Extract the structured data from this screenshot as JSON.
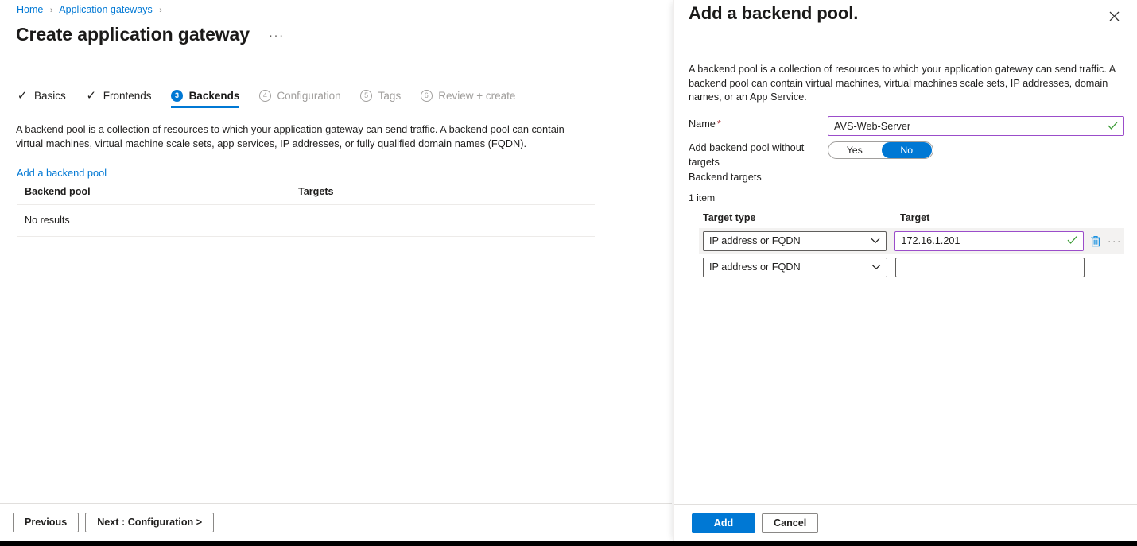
{
  "breadcrumb": {
    "items": [
      "Home",
      "Application gateways"
    ],
    "separator": "›"
  },
  "page": {
    "title": "Create application gateway",
    "ellipsis": "···"
  },
  "wizard": {
    "steps": [
      {
        "label": "Basics",
        "mark": "✓",
        "state": "done"
      },
      {
        "label": "Frontends",
        "mark": "✓",
        "state": "done"
      },
      {
        "label": "Backends",
        "mark": "3",
        "state": "active"
      },
      {
        "label": "Configuration",
        "mark": "4",
        "state": "disabled"
      },
      {
        "label": "Tags",
        "mark": "5",
        "state": "disabled"
      },
      {
        "label": "Review + create",
        "mark": "6",
        "state": "disabled"
      }
    ]
  },
  "main": {
    "description": "A backend pool is a collection of resources to which your application gateway can send traffic. A backend pool can contain virtual machines, virtual machine scale sets, app services, IP addresses, or fully qualified domain names (FQDN).",
    "add_pool_link": "Add a backend pool",
    "table": {
      "columns": [
        "Backend pool",
        "Targets"
      ],
      "empty_text": "No results"
    }
  },
  "footer": {
    "previous_label": "Previous",
    "next_label": "Next : Configuration >"
  },
  "panel": {
    "title": "Add a backend pool.",
    "close_icon": "✕",
    "description": "A backend pool is a collection of resources to which your application gateway can send traffic. A backend pool can contain virtual machines, virtual machines scale sets, IP addresses, domain names, or an App Service.",
    "name_field": {
      "label": "Name",
      "required_marker": "*",
      "value": "AVS-Web-Server",
      "placeholder": "",
      "valid_icon": "✓"
    },
    "without_targets": {
      "label": "Add backend pool without targets",
      "options": [
        "Yes",
        "No"
      ],
      "selected": "No"
    },
    "backend_targets_label": "Backend targets",
    "item_count": "1 item",
    "targets_table": {
      "columns": [
        "Target type",
        "Target"
      ],
      "rows": [
        {
          "target_type": "IP address or FQDN",
          "target_value": "172.16.1.201",
          "target_placeholder": "",
          "valid_icon": "✓",
          "highlighted": true,
          "delete_icon": "delete-icon",
          "more_icon": "···"
        },
        {
          "target_type": "IP address or FQDN",
          "target_value": "",
          "target_placeholder": "",
          "valid_icon": "",
          "highlighted": false,
          "delete_icon": "",
          "more_icon": ""
        }
      ]
    },
    "footer": {
      "add_label": "Add",
      "cancel_label": "Cancel"
    }
  },
  "colors": {
    "accent": "#0078d4",
    "valid_green": "#3a9b35",
    "required_red": "#a4262c",
    "focus_purple": "#9b4dca"
  }
}
